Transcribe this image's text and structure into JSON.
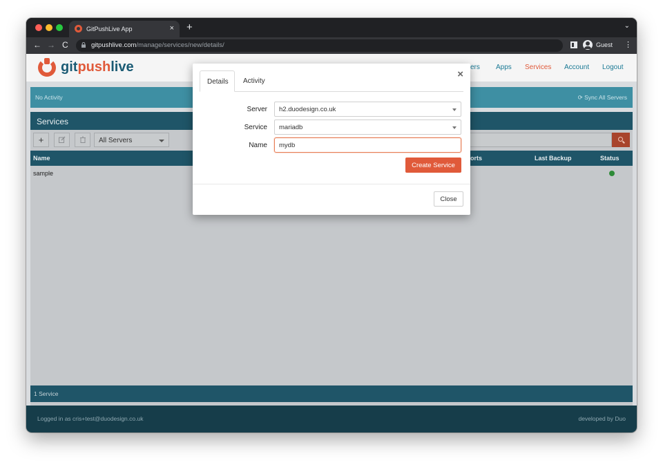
{
  "browser": {
    "tab_title": "GitPushLive App",
    "tab_close": "×",
    "new_tab": "+",
    "tab_menu": "⌄",
    "back": "←",
    "forward": "→",
    "reload": "C",
    "url_host": "gitpushlive.com",
    "url_path": "/manage/services/new/details/",
    "profile_label": "Guest",
    "menu": "⋮"
  },
  "site": {
    "logo_prefix": "git",
    "logo_accent": "push",
    "logo_suffix": "live",
    "nav": [
      {
        "label": "vers",
        "active": false
      },
      {
        "label": "Apps",
        "active": false
      },
      {
        "label": "Services",
        "active": true
      },
      {
        "label": "Account",
        "active": false
      },
      {
        "label": "Logout",
        "active": false
      }
    ],
    "activity_text": "No Activity",
    "sync_label": "Sync All Servers"
  },
  "panel": {
    "title": "Services",
    "add_icon": "+",
    "server_filter": "All Servers",
    "columns": [
      "Name",
      "orts",
      "Last Backup",
      "Status"
    ],
    "rows": [
      {
        "name": "sample",
        "status_color": "#2e8b38"
      }
    ],
    "footer": "1 Service"
  },
  "footer": {
    "logged_in": "Logged in as cris+test@duodesign.co.uk",
    "credit": "developed by Duo"
  },
  "modal": {
    "close_icon": "×",
    "tabs": [
      "Details",
      "Activity"
    ],
    "server_label": "Server",
    "server_value": "h2.duodesign.co.uk",
    "service_label": "Service",
    "service_value": "mariadb",
    "name_label": "Name",
    "name_value": "mydb",
    "create_label": "Create Service",
    "close_label": "Close"
  },
  "colors": {
    "accent": "#e05a3a",
    "brand_dark": "#1f5568",
    "status_ok": "#2e8b38"
  }
}
